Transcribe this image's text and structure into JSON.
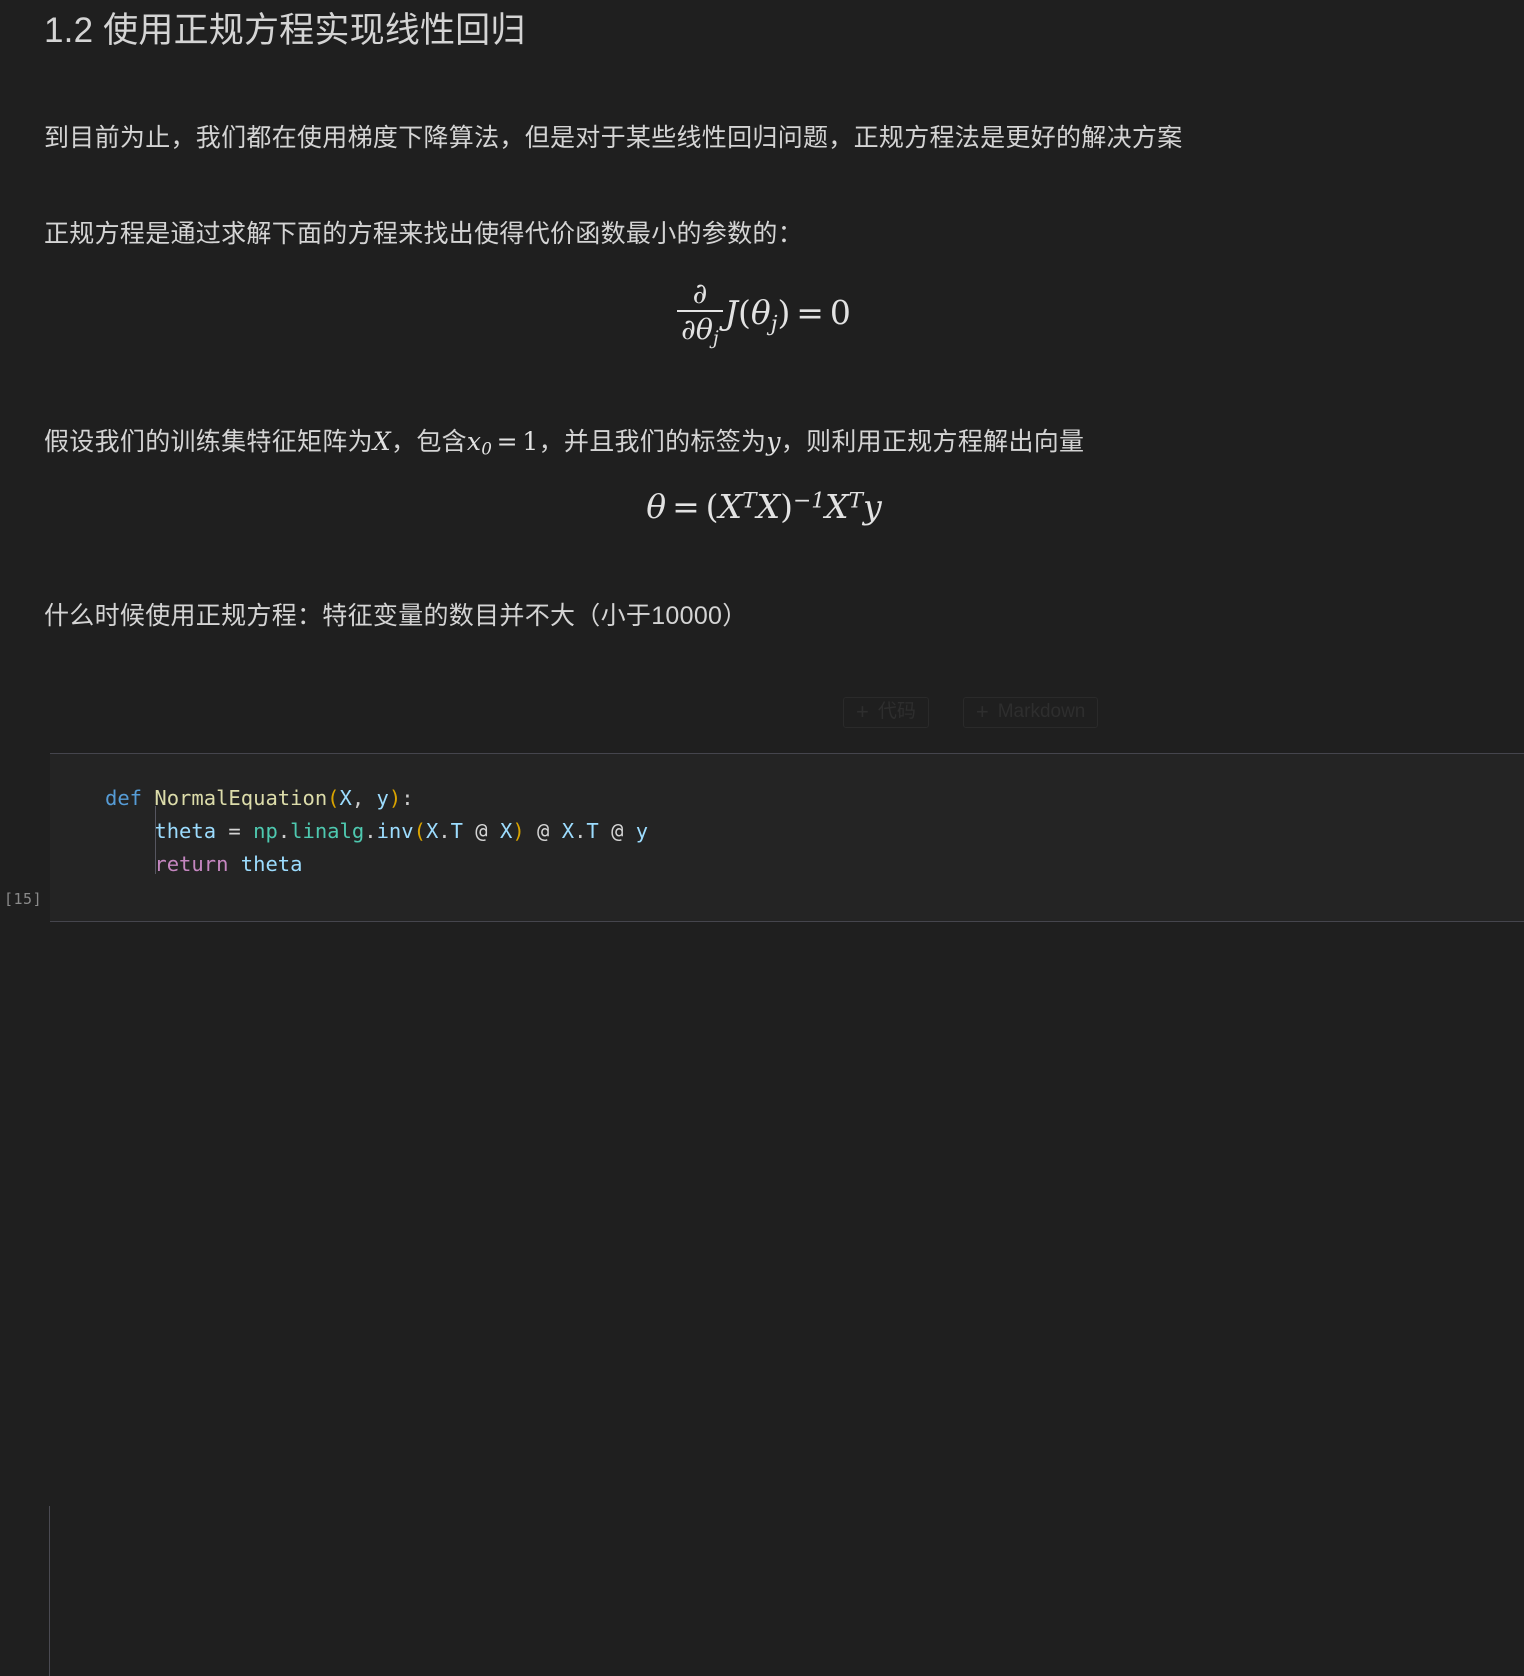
{
  "notebook": {
    "background_color": "#1f1f1f",
    "text_color": "#d4d4d4"
  },
  "markdown_cell": {
    "heading": "1.2 使用正规方程实现线性回归",
    "paragraph_1": "到目前为止，我们都在使用梯度下降算法，但是对于某些线性回归问题，正规方程法是更好的解决方案",
    "paragraph_2": "正规方程是通过求解下面的方程来找出使得代价函数最小的参数的：",
    "formula_1": {
      "latex": "\\frac{\\partial}{\\partial \\theta_j} J(\\theta_j) = 0",
      "numerator": "∂",
      "denominator_partial": "∂",
      "denominator_theta": "θ",
      "denominator_sub": "j",
      "function": "J",
      "open_paren": "(",
      "arg_theta": "θ",
      "arg_sub": "j",
      "close_paren": ")",
      "equals": "=",
      "rhs": "0"
    },
    "paragraph_3": {
      "part_1": "假设我们的训练集特征矩阵为",
      "var_X": "X",
      "part_2": "，包含",
      "var_x": "x",
      "var_x_sub": "0",
      "equals": "=",
      "value_one": "1",
      "part_3": "，并且我们的标签为",
      "var_y": "y",
      "part_4": "，则利用正规方程解出向量"
    },
    "formula_2": {
      "latex": "\\theta = (X^T X)^{-1} X^T y",
      "theta": "θ",
      "equals": "=",
      "open_paren": "(",
      "X_1": "X",
      "sup_T_1": "T",
      "X_2": "X",
      "close_paren": ")",
      "sup_inv": "−1",
      "X_3": "X",
      "sup_T_2": "T",
      "y": "y"
    },
    "paragraph_4": "什么时候使用正规方程：特征变量的数目并不大（小于10000）"
  },
  "add_cell_toolbar": {
    "code_button": {
      "plus": "+",
      "label": "代码"
    },
    "markdown_button": {
      "plus": "+",
      "label": "Markdown"
    }
  },
  "code_cell": {
    "execution_count": "[15]",
    "language": "python",
    "background_color": "#242424",
    "lines": [
      {
        "tokens": [
          {
            "text": "def",
            "type": "keyword",
            "color": "#569cd6"
          },
          {
            "text": " ",
            "type": "plain",
            "color": "#cccccc"
          },
          {
            "text": "NormalEquation",
            "type": "function",
            "color": "#dcdcaa"
          },
          {
            "text": "(",
            "type": "paren",
            "color": "#d9a300"
          },
          {
            "text": "X",
            "type": "variable",
            "color": "#9cdcfe"
          },
          {
            "text": ", ",
            "type": "punct",
            "color": "#cccccc"
          },
          {
            "text": "y",
            "type": "variable",
            "color": "#9cdcfe"
          },
          {
            "text": ")",
            "type": "paren",
            "color": "#d9a300"
          },
          {
            "text": ":",
            "type": "punct",
            "color": "#cccccc"
          }
        ],
        "plain": "def NormalEquation(X, y):"
      },
      {
        "tokens": [
          {
            "text": "    ",
            "type": "plain",
            "color": "#cccccc"
          },
          {
            "text": "theta",
            "type": "variable",
            "color": "#9cdcfe"
          },
          {
            "text": " = ",
            "type": "operator",
            "color": "#d4d4d4"
          },
          {
            "text": "np",
            "type": "module",
            "color": "#4ec9b0"
          },
          {
            "text": ".",
            "type": "punct",
            "color": "#cccccc"
          },
          {
            "text": "linalg",
            "type": "module",
            "color": "#4ec9b0"
          },
          {
            "text": ".",
            "type": "punct",
            "color": "#cccccc"
          },
          {
            "text": "inv",
            "type": "attribute",
            "color": "#9cdcfe"
          },
          {
            "text": "(",
            "type": "paren",
            "color": "#d9a300"
          },
          {
            "text": "X",
            "type": "variable",
            "color": "#9cdcfe"
          },
          {
            "text": ".",
            "type": "punct",
            "color": "#cccccc"
          },
          {
            "text": "T",
            "type": "attribute",
            "color": "#9cdcfe"
          },
          {
            "text": " @ ",
            "type": "operator",
            "color": "#d4d4d4"
          },
          {
            "text": "X",
            "type": "variable",
            "color": "#9cdcfe"
          },
          {
            "text": ")",
            "type": "paren",
            "color": "#d9a300"
          },
          {
            "text": " @ ",
            "type": "operator",
            "color": "#d4d4d4"
          },
          {
            "text": "X",
            "type": "variable",
            "color": "#9cdcfe"
          },
          {
            "text": ".",
            "type": "punct",
            "color": "#cccccc"
          },
          {
            "text": "T",
            "type": "attribute",
            "color": "#9cdcfe"
          },
          {
            "text": " @ ",
            "type": "operator",
            "color": "#d4d4d4"
          },
          {
            "text": "y",
            "type": "variable",
            "color": "#9cdcfe"
          }
        ],
        "plain": "    theta = np.linalg.inv(X.T @ X) @ X.T @ y"
      },
      {
        "tokens": [
          {
            "text": "    ",
            "type": "plain",
            "color": "#cccccc"
          },
          {
            "text": "return",
            "type": "keyword-return",
            "color": "#c586c0"
          },
          {
            "text": " ",
            "type": "plain",
            "color": "#cccccc"
          },
          {
            "text": "theta",
            "type": "variable",
            "color": "#9cdcfe"
          }
        ],
        "plain": "    return theta"
      }
    ]
  }
}
